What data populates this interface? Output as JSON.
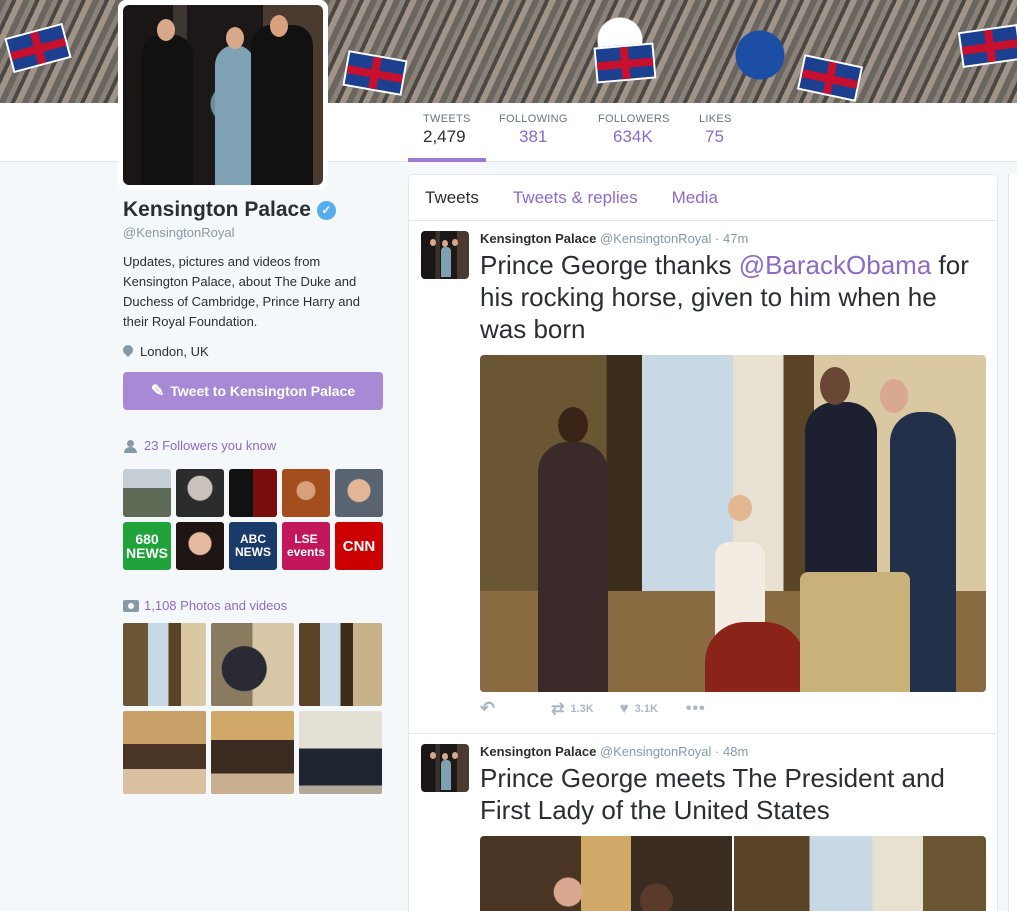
{
  "profile": {
    "name": "Kensington Palace",
    "handle": "@KensingtonRoyal",
    "bio": "Updates, pictures and videos from Kensington Palace, about The Duke and Duchess of Cambridge, Prince Harry and their Royal Foundation.",
    "location": "London, UK",
    "tweet_to_label": "Tweet to Kensington Palace"
  },
  "stats": [
    {
      "label": "TWEETS",
      "value": "2,479"
    },
    {
      "label": "FOLLOWING",
      "value": "381"
    },
    {
      "label": "FOLLOWERS",
      "value": "634K"
    },
    {
      "label": "LIKES",
      "value": "75"
    }
  ],
  "followers_you_know": {
    "label": "23 Followers you know",
    "tiles": [
      {
        "text": "",
        "color": "#7d8c7a"
      },
      {
        "text": "",
        "color": "#3a3a3a"
      },
      {
        "text": "",
        "color": "#8a1a1a"
      },
      {
        "text": "",
        "color": "#9a4a1a"
      },
      {
        "text": "",
        "color": "#6a6a6a"
      },
      {
        "text": "680 NEWS",
        "color": "#1fa33a"
      },
      {
        "text": "",
        "color": "#2a1c1a"
      },
      {
        "text": "ABC NEWS",
        "color": "#1a3a6a"
      },
      {
        "text": "LSE events",
        "color": "#c2185b"
      },
      {
        "text": "CNN",
        "color": "#cc0000"
      }
    ]
  },
  "photos": {
    "label": "1,108 Photos and videos"
  },
  "tabs": [
    "Tweets",
    "Tweets & replies",
    "Media"
  ],
  "tweets": [
    {
      "name": "Kensington Palace",
      "handle": "@KensingtonRoyal",
      "time": "· 47m",
      "text_before": "Prince George thanks ",
      "mention": "@BarackObama",
      "text_after": " for his rocking horse, given to him when he was born",
      "retweets": "1.3K",
      "likes": "3.1K"
    },
    {
      "name": "Kensington Palace",
      "handle": "@KensingtonRoyal",
      "time": "· 48m",
      "text": "Prince George meets The President and First Lady of the United States"
    }
  ],
  "icons": {
    "verified": "verified-badge-icon",
    "location": "pin-icon",
    "tweet_to": "quill-icon",
    "followers": "user-icon",
    "photos": "camera-icon",
    "reply": "reply-icon",
    "retweet": "retweet-icon",
    "like": "heart-icon",
    "more": "more-icon"
  },
  "colors": {
    "accent": "#8c6ac8",
    "button": "#a889d6",
    "verified": "#55acee"
  }
}
